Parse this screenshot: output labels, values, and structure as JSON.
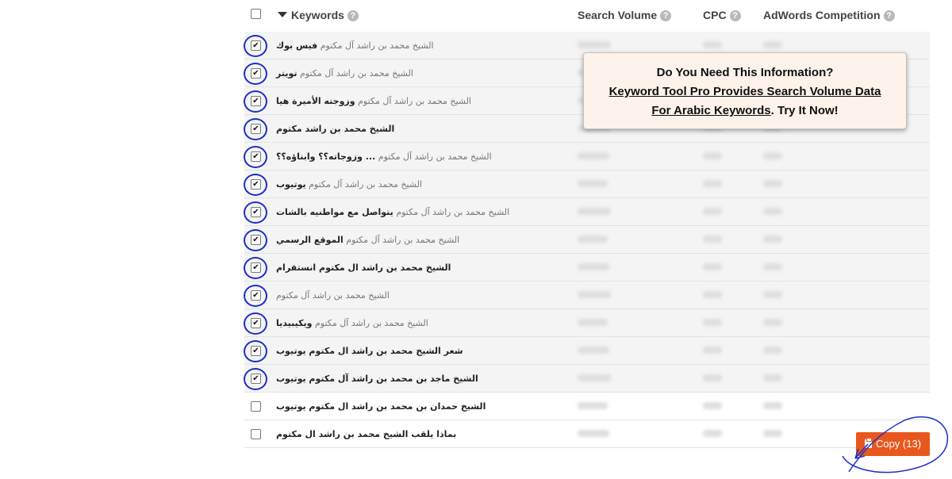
{
  "header": {
    "keywords_label": "Keywords",
    "search_volume_label": "Search Volume",
    "cpc_label": "CPC",
    "competition_label": "AdWords Competition",
    "help_glyph": "?"
  },
  "rows": [
    {
      "prefix": "الشيخ محمد بن راشد آل مكتوم",
      "suffix": "فيس بوك",
      "checked": true
    },
    {
      "prefix": "الشيخ محمد بن راشد آل مكتوم",
      "suffix": "تويتر",
      "checked": true
    },
    {
      "prefix": "الشيخ محمد بن راشد آل مكتوم",
      "suffix": "وزوجته الأميرة هيا",
      "checked": true
    },
    {
      "prefix": "",
      "suffix": "الشيخ محمد بن راشد مكتوم",
      "checked": true
    },
    {
      "prefix": "الشيخ محمد بن راشد آل مكتوم",
      "suffix": "... وزوجاته؟؟ وابناؤه؟؟",
      "checked": true
    },
    {
      "prefix": "الشيخ محمد بن راشد آل مكتوم",
      "suffix": "يوتيوب",
      "checked": true
    },
    {
      "prefix": "الشيخ محمد بن راشد آل مكتوم",
      "suffix": "يتواصل مع مواطنيه بالشات",
      "checked": true
    },
    {
      "prefix": "الشيخ محمد بن راشد آل مكتوم",
      "suffix": "الموقع الرسمي",
      "checked": true
    },
    {
      "prefix": "",
      "suffix": "الشيخ محمد بن راشد ال مكتوم انستقرام",
      "checked": true
    },
    {
      "prefix": "الشيخ محمد بن راشد آل مكتوم",
      "suffix": "",
      "checked": true
    },
    {
      "prefix": "الشيخ محمد بن راشد آل مكتوم",
      "suffix": "ويكيبيديا",
      "checked": true
    },
    {
      "prefix": "",
      "suffix": "شعر الشيخ محمد بن راشد ال مكتوم يوتيوب",
      "checked": true
    },
    {
      "prefix": "",
      "suffix": "الشيخ ماجد بن محمد بن راشد آل مكتوم يوتيوب",
      "checked": true
    },
    {
      "prefix": "",
      "suffix": "الشيخ حمدان بن محمد بن راشد ال مكتوم يوتيوب",
      "checked": false
    },
    {
      "prefix": "",
      "suffix": "بماذا يلقب الشيخ محمد بن راشد ال مكتوم",
      "checked": false
    }
  ],
  "popup": {
    "title": "Do You Need This Information?",
    "line2": "Keyword Tool Pro Provides Search Volume Data",
    "line3_link": "For Arabic Keywords",
    "line3_rest": ". Try It Now!"
  },
  "copy_button": {
    "label": "Copy (13)",
    "color": "#e8581e"
  },
  "icons": {
    "sort": "caret-down-icon",
    "help": "question-circle-icon",
    "copy": "clipboard-icon"
  },
  "colors": {
    "annotation": "#1b2ec9",
    "selected_row": "#f4f4f4"
  }
}
